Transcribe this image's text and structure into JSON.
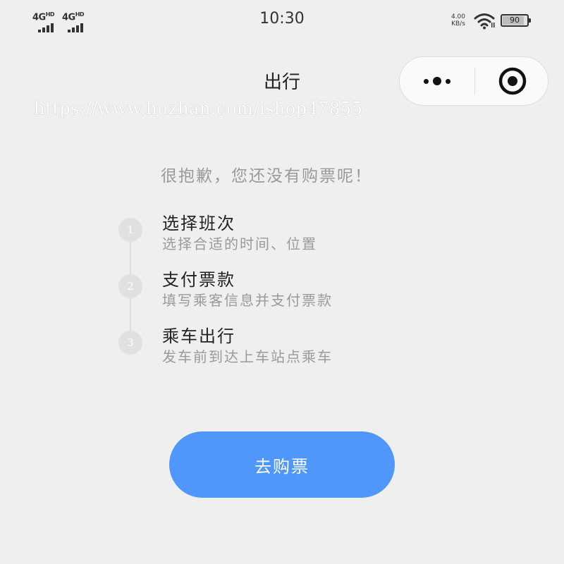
{
  "status_bar": {
    "signal_1": "4G",
    "signal_1_sup": "HD",
    "signal_2": "4G",
    "signal_2_sup": "HD",
    "time": "10:30",
    "net_speed_value": "4.00",
    "net_speed_unit": "KB/s",
    "battery_level": 90,
    "battery_label": "90"
  },
  "nav": {
    "title": "出行",
    "watermark": "https://www.huzhan.com/ishop47855"
  },
  "main": {
    "notice": "很抱歉，您还没有购票呢！",
    "steps": [
      {
        "num": "1",
        "title": "选择班次",
        "desc": "选择合适的时间、位置"
      },
      {
        "num": "2",
        "title": "支付票款",
        "desc": "填写乘客信息并支付票款"
      },
      {
        "num": "3",
        "title": "乘车出行",
        "desc": "发车前到达上车站点乘车"
      }
    ],
    "buy_button_label": "去购票"
  },
  "colors": {
    "background": "#efefef",
    "button": "#4f97fa",
    "step_circle": "#e0e0e0",
    "muted_text": "#9a9a9a"
  },
  "icons": {
    "more": "more-dots-icon",
    "close": "mini-program-close-icon",
    "wifi": "wifi-icon",
    "battery": "battery-icon",
    "signal": "signal-bars-icon"
  }
}
